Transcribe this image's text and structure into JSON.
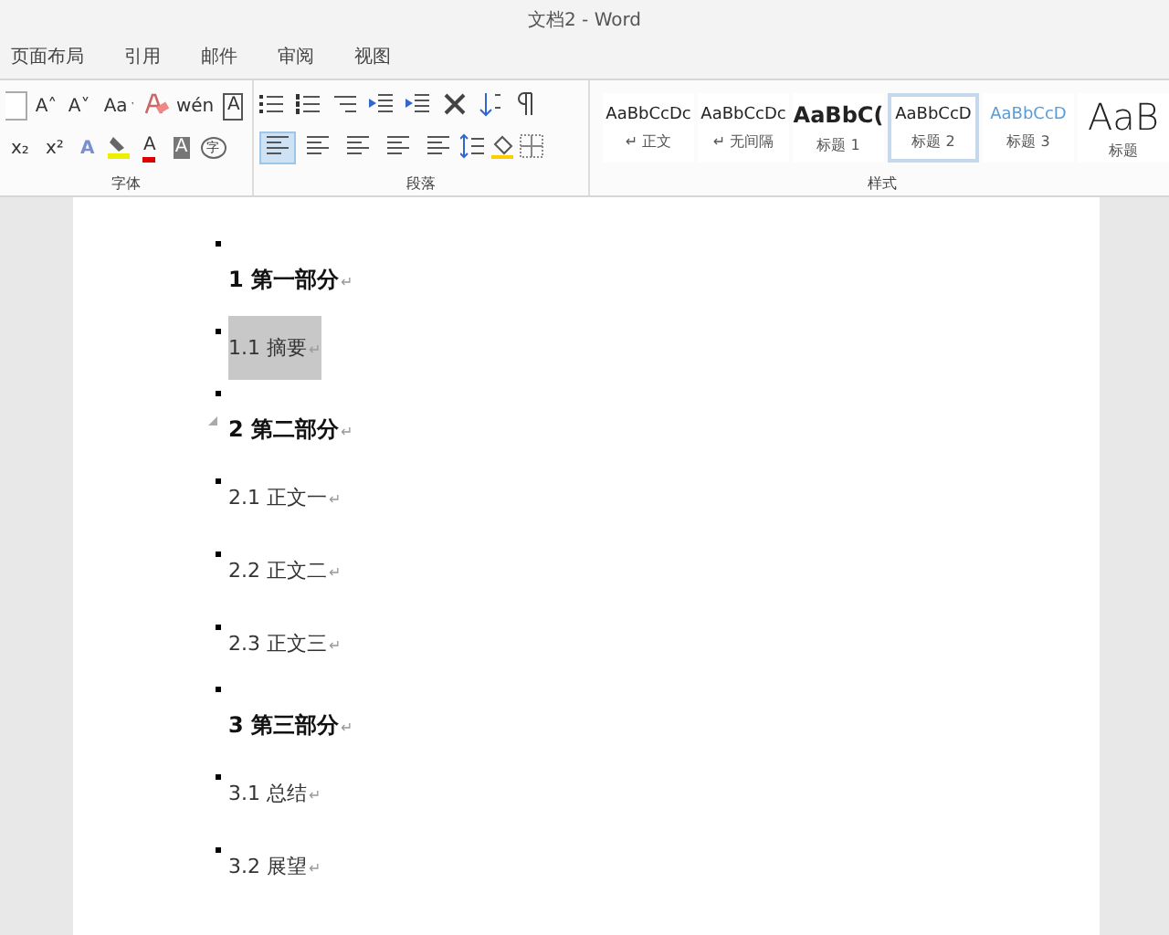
{
  "window": {
    "title": "文档2 - Word"
  },
  "tabs": [
    {
      "label": "页面布局",
      "selected": false
    },
    {
      "label": "引用",
      "selected": false
    },
    {
      "label": "邮件",
      "selected": false
    },
    {
      "label": "审阅",
      "selected": false
    },
    {
      "label": "视图",
      "selected": false
    }
  ],
  "font_group": {
    "label": "字体",
    "row1": [
      {
        "kind": "sizebox"
      },
      {
        "kind": "text",
        "label": "A˄"
      },
      {
        "kind": "text",
        "label": "A˅"
      },
      {
        "kind": "textdrop",
        "label": "Aa"
      },
      {
        "kind": "eraser"
      },
      {
        "kind": "text",
        "label": "wén"
      },
      {
        "kind": "boxed",
        "label": "A"
      }
    ],
    "row2": [
      {
        "kind": "text",
        "label": "x₂"
      },
      {
        "kind": "text",
        "label": "x²"
      },
      {
        "kind": "outline",
        "label": "A"
      },
      {
        "kind": "highlighter"
      },
      {
        "kind": "fontcolor",
        "label": "A"
      },
      {
        "kind": "shaded",
        "label": "A"
      },
      {
        "kind": "circled",
        "label": "字"
      }
    ]
  },
  "paragraph_group": {
    "label": "段落",
    "row1": [
      {
        "kind": "bullets"
      },
      {
        "kind": "numbering"
      },
      {
        "kind": "multilevel"
      },
      {
        "kind": "outdent"
      },
      {
        "kind": "indent"
      },
      {
        "kind": "chinese"
      },
      {
        "kind": "sort"
      },
      {
        "kind": "marks"
      }
    ],
    "row2": [
      {
        "kind": "align",
        "selected": true
      },
      {
        "kind": "align",
        "selected": false
      },
      {
        "kind": "align",
        "selected": false
      },
      {
        "kind": "align",
        "selected": false
      },
      {
        "kind": "align",
        "selected": false
      },
      {
        "kind": "spacing"
      },
      {
        "kind": "fill"
      },
      {
        "kind": "border"
      }
    ]
  },
  "styles_group": {
    "label": "样式",
    "items": [
      {
        "kind": "normal",
        "preview": "AaBbCcDc",
        "name": "↵ 正文",
        "selected": false
      },
      {
        "kind": "normal",
        "preview": "AaBbCcDc",
        "name": "↵ 无间隔",
        "selected": false
      },
      {
        "kind": "heading1",
        "preview": "AaBbC(",
        "name": "标题 1",
        "selected": false
      },
      {
        "kind": "heading2",
        "preview": "AaBbCcD",
        "name": "标题 2",
        "selected": true
      },
      {
        "kind": "heading3",
        "preview": "AaBbCcD",
        "name": "标题 3",
        "selected": false
      },
      {
        "kind": "title",
        "preview": "AaB",
        "name": "标题",
        "selected": false
      }
    ]
  },
  "document": {
    "paragraphs": [
      {
        "kind": "heading",
        "text": "1 第一部分",
        "end_mark": "↵",
        "selected": false,
        "collapsible": false
      },
      {
        "kind": "body",
        "text": "1.1 摘要",
        "end_mark": "↵",
        "selected": true,
        "collapsible": false
      },
      {
        "kind": "heading",
        "text": "2 第二部分",
        "end_mark": "↵",
        "selected": false,
        "collapsible": true
      },
      {
        "kind": "body",
        "text": "2.1 正文一",
        "end_mark": "↵",
        "selected": false,
        "collapsible": false
      },
      {
        "kind": "body",
        "text": "2.2 正文二",
        "end_mark": "↵",
        "selected": false,
        "collapsible": false
      },
      {
        "kind": "body",
        "text": "2.3 正文三",
        "end_mark": "↵",
        "selected": false,
        "collapsible": false
      },
      {
        "kind": "heading",
        "text": "3 第三部分",
        "end_mark": "↵",
        "selected": false,
        "collapsible": false
      },
      {
        "kind": "body",
        "text": "3.1 总结",
        "end_mark": "↵",
        "selected": false,
        "collapsible": false
      },
      {
        "kind": "body",
        "text": "3.2 展望",
        "end_mark": "↵",
        "selected": false,
        "collapsible": false
      }
    ]
  }
}
